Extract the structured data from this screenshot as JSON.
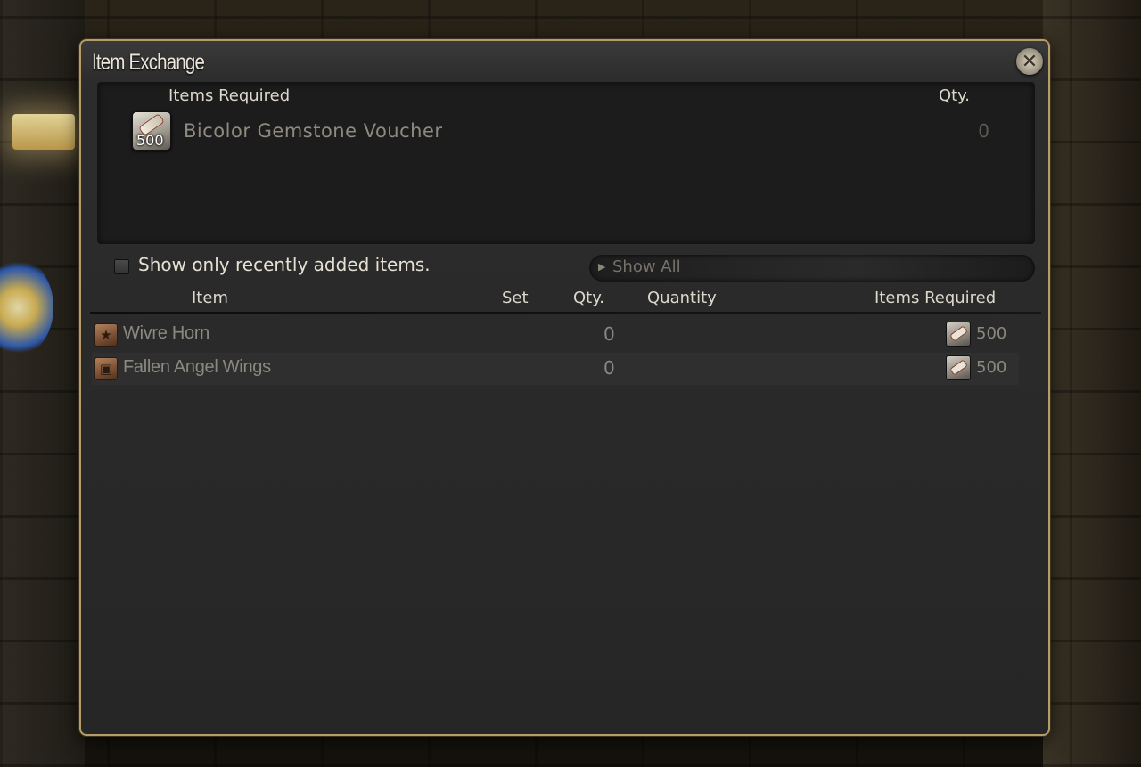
{
  "window": {
    "title": "Item Exchange",
    "close_icon": "close-icon"
  },
  "required": {
    "header_items": "Items Required",
    "header_qty": "Qty.",
    "item": {
      "name": "Bicolor Gemstone Voucher",
      "icon_amount": "500",
      "qty": "0"
    }
  },
  "filter": {
    "checkbox_label": "Show only recently added items.",
    "checked": false,
    "dropdown_value": "Show All"
  },
  "list": {
    "columns": {
      "item": "Item",
      "set": "Set",
      "qty": "Qty.",
      "quantity": "Quantity",
      "items_required": "Items Required"
    },
    "rows": [
      {
        "name": "Wivre Horn",
        "icon": "star-icon",
        "qty": "0",
        "required_amount": "500"
      },
      {
        "name": "Fallen Angel Wings",
        "icon": "chest-icon",
        "qty": "0",
        "required_amount": "500"
      }
    ]
  }
}
